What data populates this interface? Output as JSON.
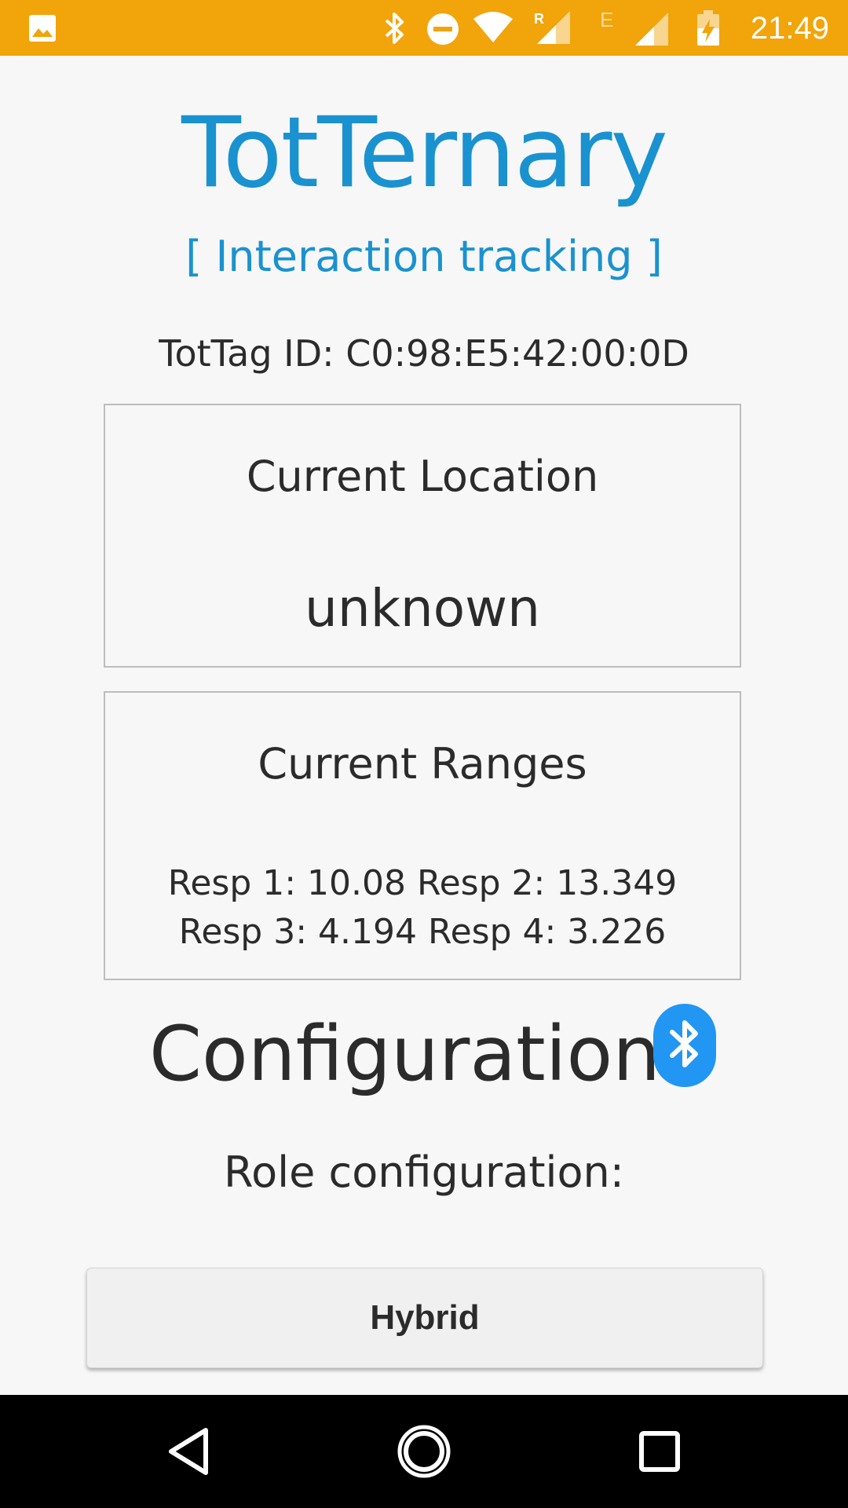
{
  "status_bar": {
    "time": "21:49",
    "background_color": "#f2a40b",
    "icons": [
      "gallery-icon",
      "bluetooth-icon",
      "do-not-disturb-icon",
      "wifi-icon",
      "cell-signal-roaming-icon",
      "cell-signal-edge-icon",
      "battery-charging-icon"
    ],
    "roaming_label": "R",
    "network_label": "E"
  },
  "header": {
    "title": "TotTernary",
    "subtitle": "[ Interaction tracking ]",
    "accent_color": "#1a92d0"
  },
  "tag": {
    "id_text": "TotTag ID: C0:98:E5:42:00:0D"
  },
  "location_panel": {
    "heading": "Current Location",
    "value": "unknown"
  },
  "ranges_panel": {
    "heading": "Current Ranges",
    "value": "Resp 1: 10.08 Resp 2: 13.349 Resp 3: 4.194 Resp 4: 3.226"
  },
  "configuration": {
    "title": "Configuration",
    "bluetooth_icon": "bluetooth-icon",
    "bluetooth_color": "#2196f3",
    "role_label": "Role configuration:",
    "role_button_label": "Hybrid"
  },
  "nav_bar": {
    "icons": [
      "back-icon",
      "home-icon",
      "recent-apps-icon"
    ]
  }
}
